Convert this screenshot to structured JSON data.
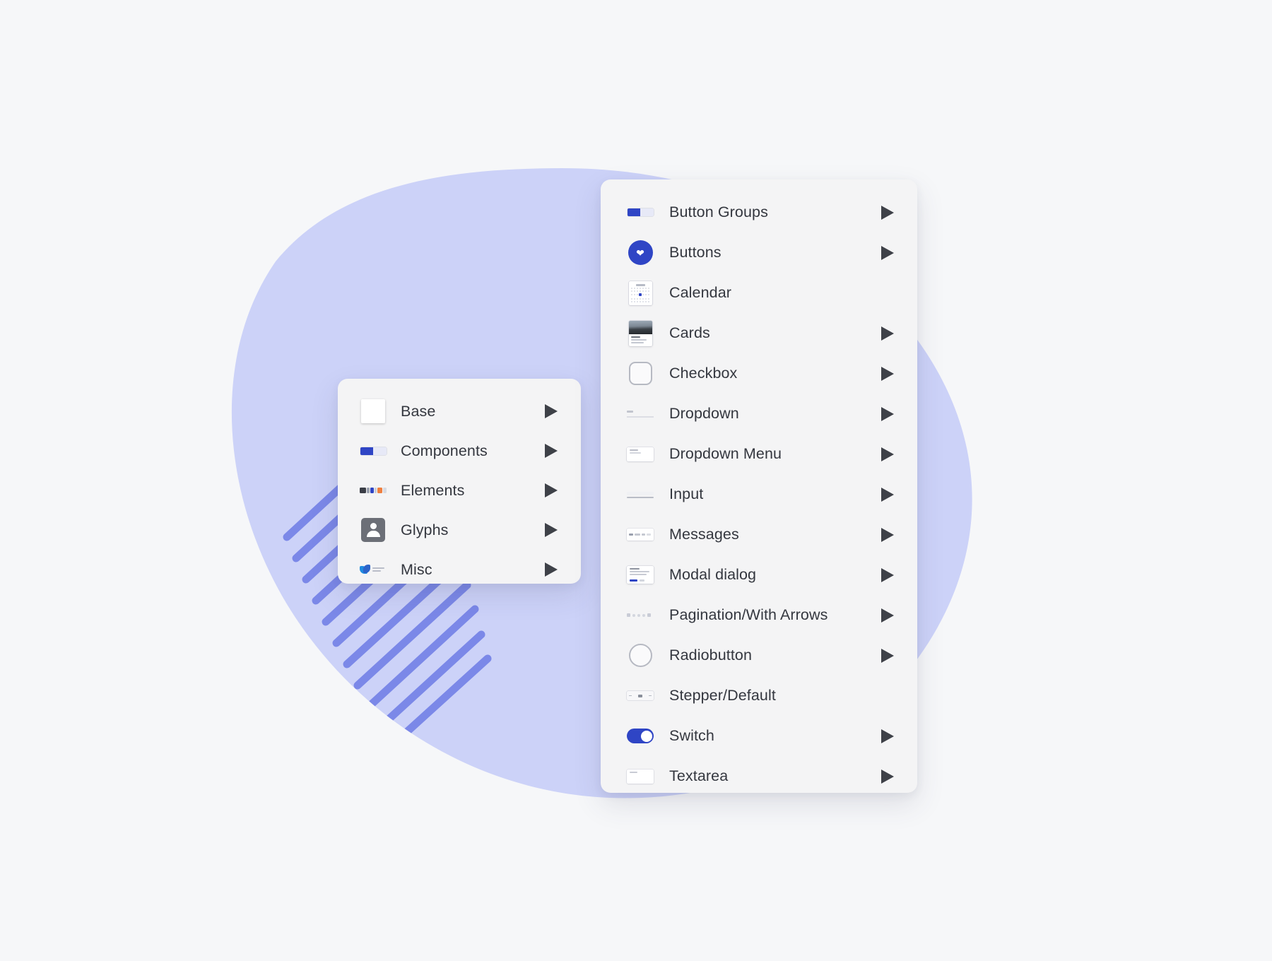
{
  "canvas": {
    "background_color": "#f6f7f9",
    "blob_color": "#ccd2f8",
    "stripe_color": "#7b88e8"
  },
  "panels": {
    "components_menu": {
      "name": "Components category menu",
      "items": [
        {
          "label": "Base",
          "icon": "white-square-icon",
          "has_submenu": true
        },
        {
          "label": "Components",
          "icon": "button-group-icon",
          "has_submenu": true
        },
        {
          "label": "Elements",
          "icon": "elements-strip-icon",
          "has_submenu": true
        },
        {
          "label": "Glyphs",
          "icon": "avatar-glyph-icon",
          "has_submenu": true
        },
        {
          "label": "Misc",
          "icon": "misc-shape-icon",
          "has_submenu": true
        }
      ]
    },
    "base_menu": {
      "name": "Base components submenu",
      "items": [
        {
          "label": "Button Groups",
          "icon": "button-group-icon",
          "has_submenu": true
        },
        {
          "label": "Buttons",
          "icon": "heart-button-icon",
          "has_submenu": true
        },
        {
          "label": "Calendar",
          "icon": "calendar-icon",
          "has_submenu": false
        },
        {
          "label": "Cards",
          "icon": "card-icon",
          "has_submenu": true
        },
        {
          "label": "Checkbox",
          "icon": "checkbox-icon",
          "has_submenu": true
        },
        {
          "label": "Dropdown",
          "icon": "dropdown-icon",
          "has_submenu": true
        },
        {
          "label": "Dropdown Menu",
          "icon": "dropdown-menu-icon",
          "has_submenu": true
        },
        {
          "label": "Input",
          "icon": "input-icon",
          "has_submenu": true
        },
        {
          "label": "Messages",
          "icon": "messages-icon",
          "has_submenu": true
        },
        {
          "label": "Modal dialog",
          "icon": "modal-dialog-icon",
          "has_submenu": true
        },
        {
          "label": "Pagination/With Arrows",
          "icon": "pagination-icon",
          "has_submenu": true
        },
        {
          "label": "Radiobutton",
          "icon": "radiobutton-icon",
          "has_submenu": true
        },
        {
          "label": "Stepper/Default",
          "icon": "stepper-icon",
          "has_submenu": false
        },
        {
          "label": "Switch",
          "icon": "switch-icon",
          "has_submenu": true
        },
        {
          "label": "Textarea",
          "icon": "textarea-icon",
          "has_submenu": true
        }
      ]
    }
  }
}
